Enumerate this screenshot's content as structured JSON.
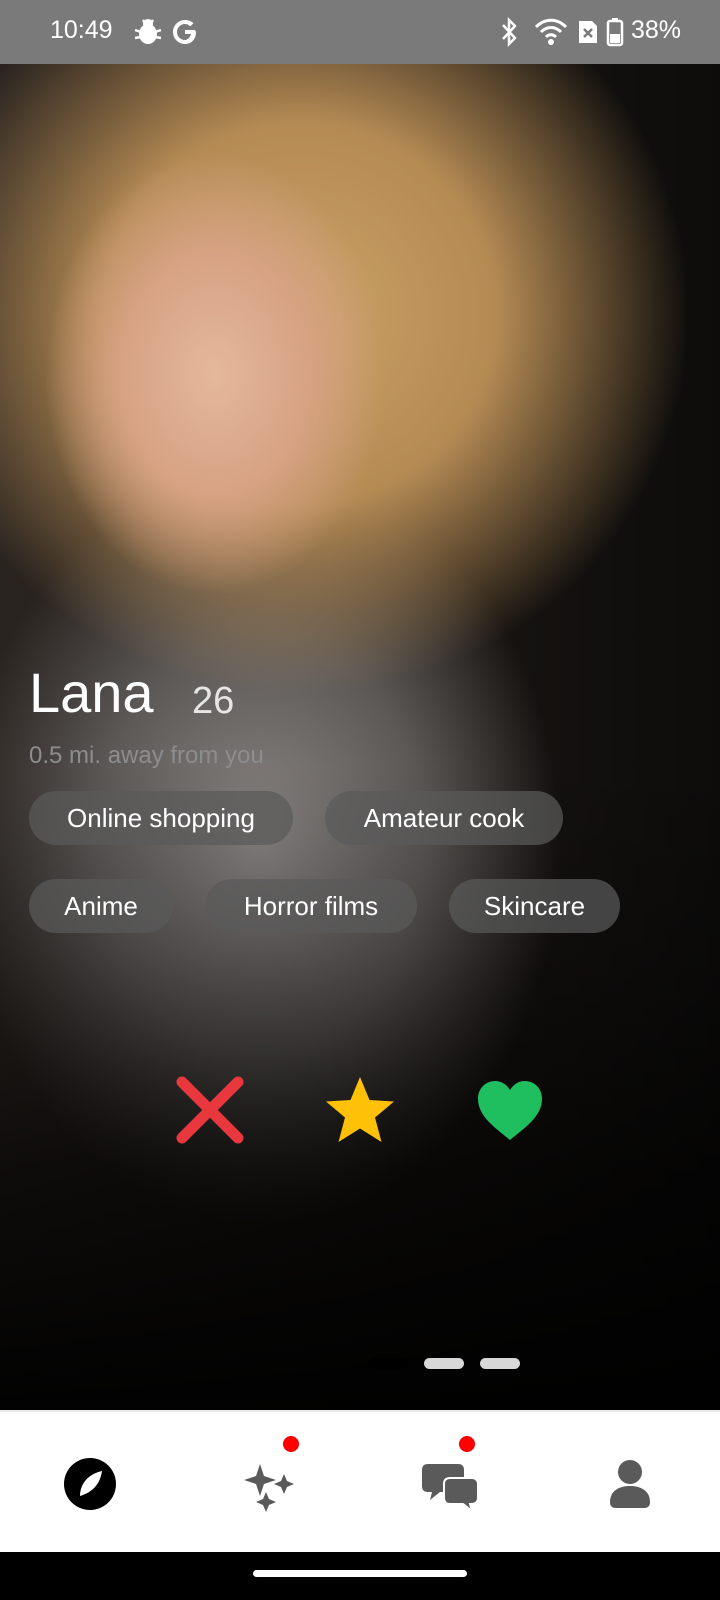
{
  "status_bar": {
    "time": "10:49",
    "battery_pct": "38%",
    "icons": [
      "bug-icon",
      "google-icon",
      "bluetooth-icon",
      "wifi-icon",
      "sim-error-icon",
      "battery-icon"
    ]
  },
  "profile": {
    "name": "Lana",
    "age": "26",
    "distance": "0.5 mi. away from you",
    "interests": [
      "Online shopping",
      "Amateur cook",
      "Anime",
      "Horror films",
      "Skincare"
    ]
  },
  "actions": {
    "pass_icon": "close-icon",
    "superlike_icon": "star-icon",
    "like_icon": "heart-icon",
    "colors": {
      "pass": "#e8383d",
      "superlike": "#ffc107",
      "like": "#1fbf5f"
    }
  },
  "photo_pager": {
    "count": 3,
    "active_index": 0
  },
  "bottom_nav": {
    "items": [
      "discover-icon",
      "sparkles-icon",
      "chat-icon",
      "profile-icon"
    ],
    "badges": [
      "sparkles-icon",
      "chat-icon"
    ],
    "badge_color": "#ff0000"
  }
}
